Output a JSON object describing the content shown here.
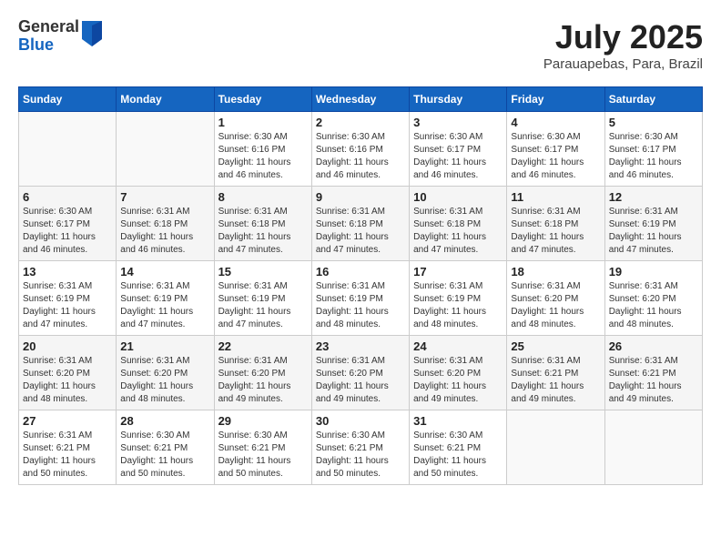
{
  "header": {
    "logo": {
      "general": "General",
      "blue": "Blue"
    },
    "title": "July 2025",
    "location": "Parauapebas, Para, Brazil"
  },
  "calendar": {
    "weekdays": [
      "Sunday",
      "Monday",
      "Tuesday",
      "Wednesday",
      "Thursday",
      "Friday",
      "Saturday"
    ],
    "weeks": [
      [
        {
          "day": "",
          "info": ""
        },
        {
          "day": "",
          "info": ""
        },
        {
          "day": "1",
          "info": "Sunrise: 6:30 AM\nSunset: 6:16 PM\nDaylight: 11 hours and 46 minutes."
        },
        {
          "day": "2",
          "info": "Sunrise: 6:30 AM\nSunset: 6:16 PM\nDaylight: 11 hours and 46 minutes."
        },
        {
          "day": "3",
          "info": "Sunrise: 6:30 AM\nSunset: 6:17 PM\nDaylight: 11 hours and 46 minutes."
        },
        {
          "day": "4",
          "info": "Sunrise: 6:30 AM\nSunset: 6:17 PM\nDaylight: 11 hours and 46 minutes."
        },
        {
          "day": "5",
          "info": "Sunrise: 6:30 AM\nSunset: 6:17 PM\nDaylight: 11 hours and 46 minutes."
        }
      ],
      [
        {
          "day": "6",
          "info": "Sunrise: 6:30 AM\nSunset: 6:17 PM\nDaylight: 11 hours and 46 minutes."
        },
        {
          "day": "7",
          "info": "Sunrise: 6:31 AM\nSunset: 6:18 PM\nDaylight: 11 hours and 46 minutes."
        },
        {
          "day": "8",
          "info": "Sunrise: 6:31 AM\nSunset: 6:18 PM\nDaylight: 11 hours and 47 minutes."
        },
        {
          "day": "9",
          "info": "Sunrise: 6:31 AM\nSunset: 6:18 PM\nDaylight: 11 hours and 47 minutes."
        },
        {
          "day": "10",
          "info": "Sunrise: 6:31 AM\nSunset: 6:18 PM\nDaylight: 11 hours and 47 minutes."
        },
        {
          "day": "11",
          "info": "Sunrise: 6:31 AM\nSunset: 6:18 PM\nDaylight: 11 hours and 47 minutes."
        },
        {
          "day": "12",
          "info": "Sunrise: 6:31 AM\nSunset: 6:19 PM\nDaylight: 11 hours and 47 minutes."
        }
      ],
      [
        {
          "day": "13",
          "info": "Sunrise: 6:31 AM\nSunset: 6:19 PM\nDaylight: 11 hours and 47 minutes."
        },
        {
          "day": "14",
          "info": "Sunrise: 6:31 AM\nSunset: 6:19 PM\nDaylight: 11 hours and 47 minutes."
        },
        {
          "day": "15",
          "info": "Sunrise: 6:31 AM\nSunset: 6:19 PM\nDaylight: 11 hours and 47 minutes."
        },
        {
          "day": "16",
          "info": "Sunrise: 6:31 AM\nSunset: 6:19 PM\nDaylight: 11 hours and 48 minutes."
        },
        {
          "day": "17",
          "info": "Sunrise: 6:31 AM\nSunset: 6:19 PM\nDaylight: 11 hours and 48 minutes."
        },
        {
          "day": "18",
          "info": "Sunrise: 6:31 AM\nSunset: 6:20 PM\nDaylight: 11 hours and 48 minutes."
        },
        {
          "day": "19",
          "info": "Sunrise: 6:31 AM\nSunset: 6:20 PM\nDaylight: 11 hours and 48 minutes."
        }
      ],
      [
        {
          "day": "20",
          "info": "Sunrise: 6:31 AM\nSunset: 6:20 PM\nDaylight: 11 hours and 48 minutes."
        },
        {
          "day": "21",
          "info": "Sunrise: 6:31 AM\nSunset: 6:20 PM\nDaylight: 11 hours and 48 minutes."
        },
        {
          "day": "22",
          "info": "Sunrise: 6:31 AM\nSunset: 6:20 PM\nDaylight: 11 hours and 49 minutes."
        },
        {
          "day": "23",
          "info": "Sunrise: 6:31 AM\nSunset: 6:20 PM\nDaylight: 11 hours and 49 minutes."
        },
        {
          "day": "24",
          "info": "Sunrise: 6:31 AM\nSunset: 6:20 PM\nDaylight: 11 hours and 49 minutes."
        },
        {
          "day": "25",
          "info": "Sunrise: 6:31 AM\nSunset: 6:21 PM\nDaylight: 11 hours and 49 minutes."
        },
        {
          "day": "26",
          "info": "Sunrise: 6:31 AM\nSunset: 6:21 PM\nDaylight: 11 hours and 49 minutes."
        }
      ],
      [
        {
          "day": "27",
          "info": "Sunrise: 6:31 AM\nSunset: 6:21 PM\nDaylight: 11 hours and 50 minutes."
        },
        {
          "day": "28",
          "info": "Sunrise: 6:30 AM\nSunset: 6:21 PM\nDaylight: 11 hours and 50 minutes."
        },
        {
          "day": "29",
          "info": "Sunrise: 6:30 AM\nSunset: 6:21 PM\nDaylight: 11 hours and 50 minutes."
        },
        {
          "day": "30",
          "info": "Sunrise: 6:30 AM\nSunset: 6:21 PM\nDaylight: 11 hours and 50 minutes."
        },
        {
          "day": "31",
          "info": "Sunrise: 6:30 AM\nSunset: 6:21 PM\nDaylight: 11 hours and 50 minutes."
        },
        {
          "day": "",
          "info": ""
        },
        {
          "day": "",
          "info": ""
        }
      ]
    ]
  }
}
